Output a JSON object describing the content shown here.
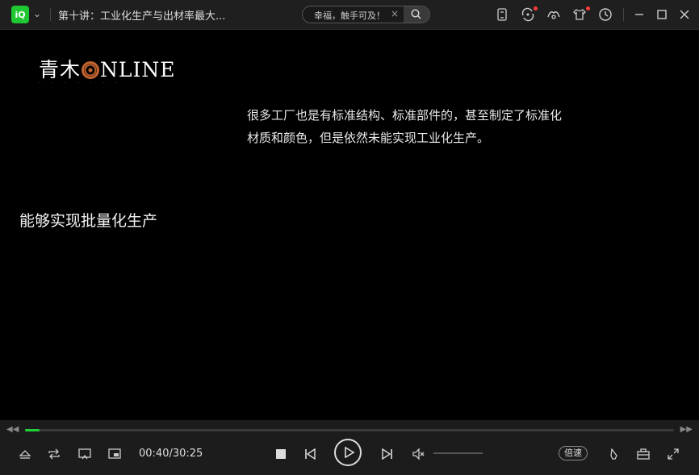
{
  "app": {
    "logo_text": "iQ"
  },
  "titlebar": {
    "title": "第十讲：工业化生产与出材率最大...",
    "search_value": "幸福，触手可及！",
    "search_clear": "×"
  },
  "video": {
    "brand_prefix": "青木",
    "brand_suffix": "NLINE",
    "subtitle_top": "很多工厂也是有标准结构、标准部件的，甚至制定了标准化材质和颜色，但是依然未能实现工业化生产。",
    "subtitle_main": "能够实现批量化生产"
  },
  "progress": {
    "played_fraction": 0.022
  },
  "controls": {
    "time_display": "00:40/30:25",
    "speed_label": "倍速"
  },
  "colors": {
    "accent": "#22d13a",
    "logo_bg": "#1fc733",
    "notification": "#ff3b3b"
  }
}
